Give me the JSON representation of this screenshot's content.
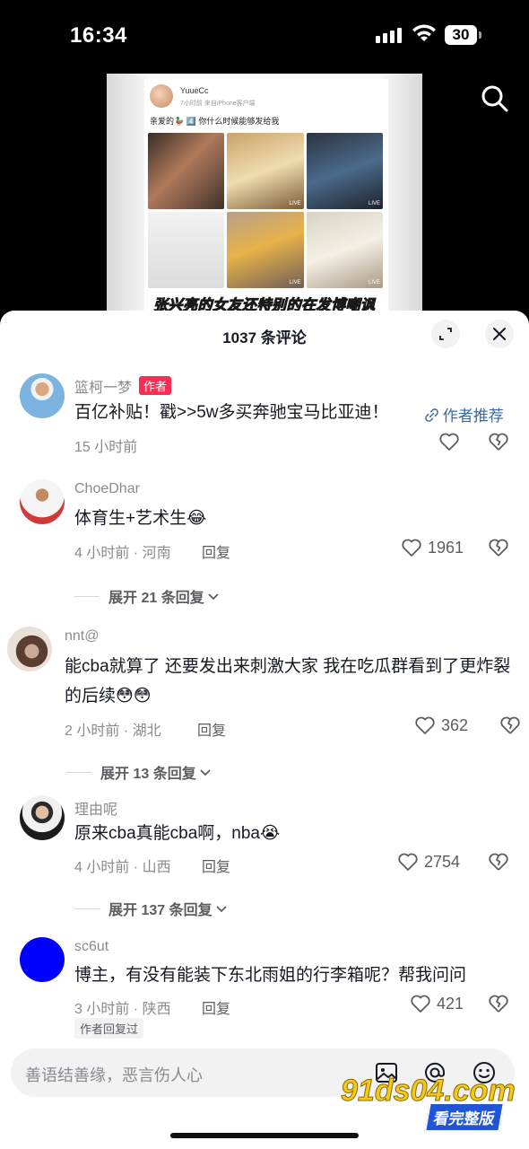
{
  "status_bar": {
    "time": "16:34",
    "battery": "30"
  },
  "video": {
    "post_user": "YuueCc",
    "post_meta": "7小时前  来自iPhone客户端",
    "post_text": "亲爱的🦆 4️⃣  你什么时候能够发给我",
    "caption": "张兴亮的女友还特别的在发博嘲讽"
  },
  "sheet": {
    "title": "1037 条评论"
  },
  "comments": [
    {
      "name": "篮柯一梦",
      "tag": "作者",
      "text": "百亿补贴！戳>>5w多买奔驰宝马比亚迪！",
      "recommend": "作者推荐",
      "meta": "15 小时前"
    },
    {
      "name": "ChoeDhar",
      "text": "体育生+艺术生😂",
      "meta": "4 小时前 · 河南",
      "reply": "回复",
      "likes": "1961",
      "expand": "展开 21 条回复"
    },
    {
      "name": "nnt@",
      "text": "能cba就算了 还要发出来刺激大家 我在吃瓜群看到了更炸裂的后续😳😳",
      "meta": "2 小时前 · 湖北",
      "reply": "回复",
      "likes": "362",
      "expand": "展开 13 条回复"
    },
    {
      "name": "理由呢",
      "text": "原来cba真能cba啊，nba😭",
      "meta": "4 小时前 · 山西",
      "reply": "回复",
      "likes": "2754",
      "expand": "展开 137 条回复"
    },
    {
      "name": "sc6ut",
      "text": "博主，有没有能装下东北雨姐的行李箱呢？帮我问问",
      "meta": "3 小时前 · 陕西",
      "reply": "回复",
      "likes": "421",
      "badge": "作者回复过"
    }
  ],
  "input": {
    "placeholder": "善语结善缘，恶言伤人心"
  },
  "watermark": {
    "site": "91ds04.com",
    "tagline": "看完整版"
  },
  "colors": {
    "author_tag": "#fe2c55",
    "link": "#3a6aa3",
    "avatar_sc6ut": "#0000ff"
  }
}
